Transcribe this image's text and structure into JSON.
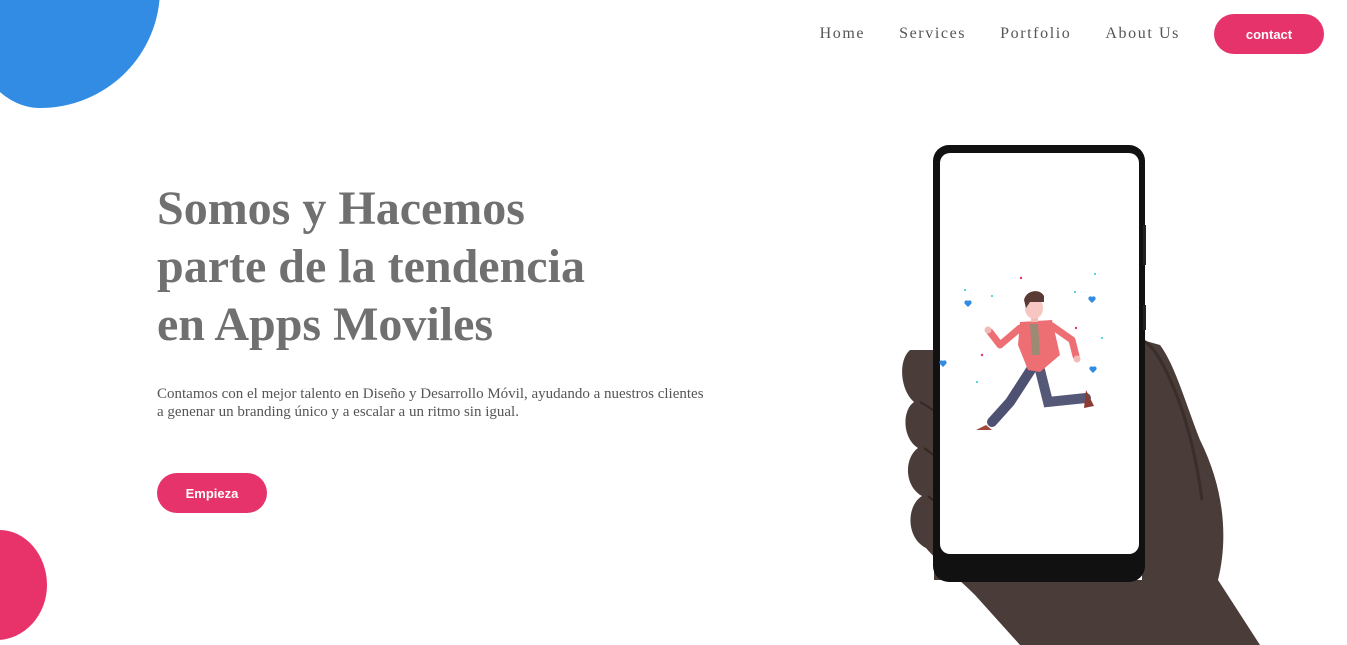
{
  "nav": {
    "links": [
      "Home",
      "Services",
      "Portfolio",
      "About Us"
    ],
    "contact_label": "contact"
  },
  "hero": {
    "title_lines": [
      "Somos y Hacemos",
      "parte de la tendencia",
      "en Apps Moviles"
    ],
    "text_line1": "Contamos con el mejor talento en Diseño y Desarrollo Móvil, ayudando a nuestros clientes",
    "text_line2": "a genenar un branding único y a escalar a un ritmo sin igual.",
    "cta_label": "Empieza"
  },
  "colors": {
    "accent_pink": "#e7336b",
    "accent_blue": "#338ce4",
    "heading_gray": "#707070"
  }
}
